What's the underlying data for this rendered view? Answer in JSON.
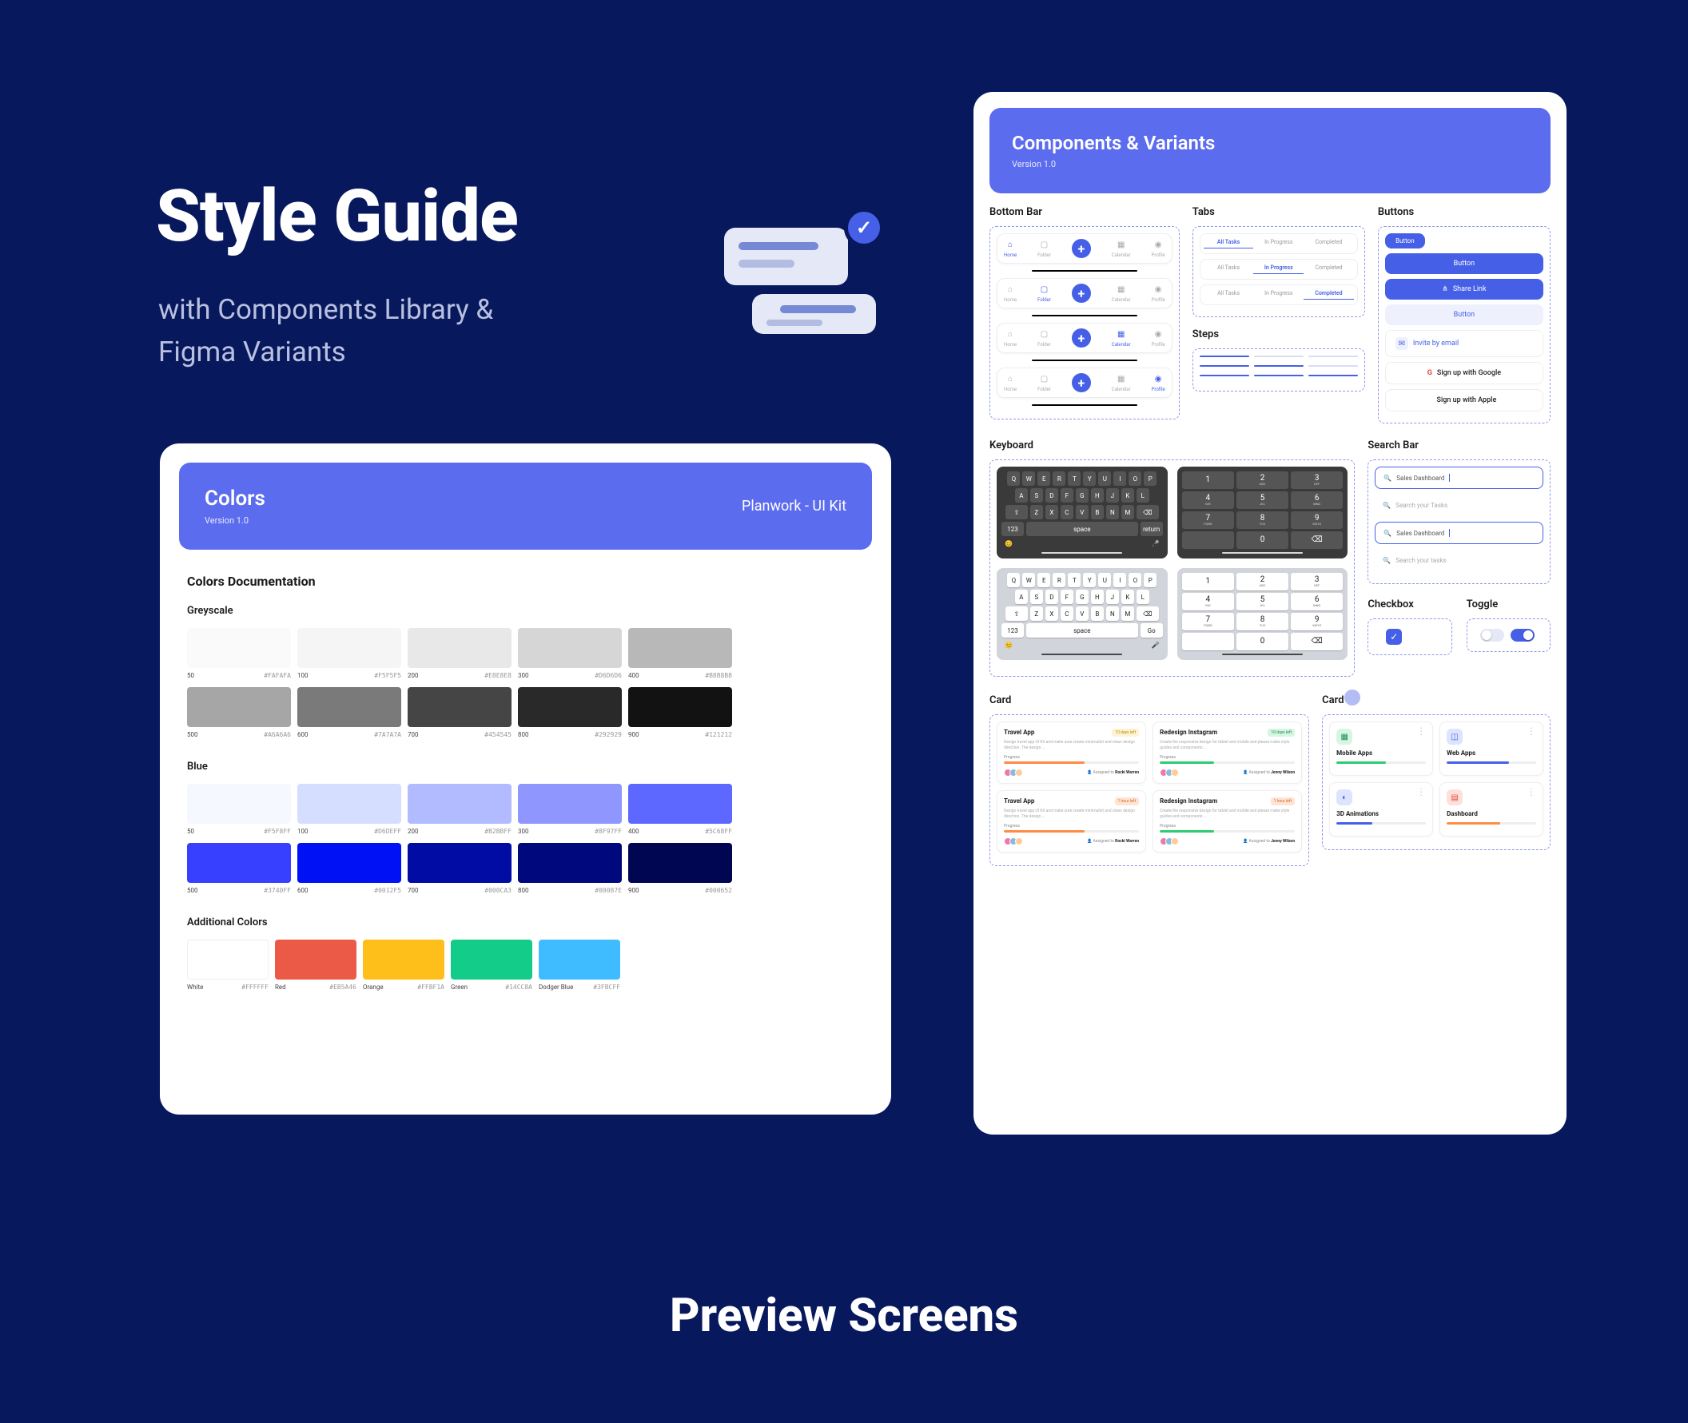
{
  "hero": {
    "title": "Style Guide",
    "subtitle_l1": "with Components Library &",
    "subtitle_l2": "Figma Variants"
  },
  "colors_panel": {
    "title": "Colors",
    "version": "Version 1.0",
    "kit": "Planwork - UI Kit",
    "doc_title": "Colors Documentation",
    "groups": {
      "greyscale": {
        "label": "Greyscale",
        "row1": [
          {
            "step": "50",
            "hex": "#FAFAFA"
          },
          {
            "step": "100",
            "hex": "#F5F5F5"
          },
          {
            "step": "200",
            "hex": "#E8E8E8"
          },
          {
            "step": "300",
            "hex": "#D6D6D6"
          },
          {
            "step": "400",
            "hex": "#B8B8B8"
          }
        ],
        "row2": [
          {
            "step": "500",
            "hex": "#A6A6A6"
          },
          {
            "step": "600",
            "hex": "#7A7A7A"
          },
          {
            "step": "700",
            "hex": "#454545"
          },
          {
            "step": "800",
            "hex": "#292929"
          },
          {
            "step": "900",
            "hex": "#121212"
          }
        ]
      },
      "blue": {
        "label": "Blue",
        "row1": [
          {
            "step": "50",
            "hex": "#F5F8FF"
          },
          {
            "step": "100",
            "hex": "#D6DEFF"
          },
          {
            "step": "200",
            "hex": "#B2BBFF"
          },
          {
            "step": "300",
            "hex": "#8F97FF"
          },
          {
            "step": "400",
            "hex": "#5C68FF"
          }
        ],
        "row2": [
          {
            "step": "500",
            "hex": "#3740FF"
          },
          {
            "step": "600",
            "hex": "#0012F5"
          },
          {
            "step": "700",
            "hex": "#000CA3"
          },
          {
            "step": "800",
            "hex": "#00087E"
          },
          {
            "step": "900",
            "hex": "#000652"
          }
        ]
      },
      "additional": {
        "label": "Additional Colors",
        "items": [
          {
            "name": "White",
            "hex": "#FFFFFF"
          },
          {
            "name": "Red",
            "hex": "#EB5A46"
          },
          {
            "name": "Orange",
            "hex": "#FFBF1A"
          },
          {
            "name": "Green",
            "hex": "#14CC8A"
          },
          {
            "name": "Dodger Blue",
            "hex": "#3FBCFF"
          }
        ]
      }
    }
  },
  "components_panel": {
    "title": "Components & Variants",
    "version": "Version 1.0",
    "sections": {
      "bottom_bar": {
        "title": "Bottom Bar",
        "items": [
          "Home",
          "Folder",
          "",
          "Calendar",
          "Profile"
        ]
      },
      "tabs": {
        "title": "Tabs",
        "labels": [
          "All Tasks",
          "In Progress",
          "Completed"
        ]
      },
      "steps": {
        "title": "Steps"
      },
      "buttons": {
        "title": "Buttons",
        "small": "Button",
        "primary": "Button",
        "share": "Share Link",
        "ghost": "Button",
        "invite": "Invite by email",
        "google": "Sign up with Google",
        "apple": "Sign up with Apple"
      },
      "keyboard": {
        "title": "Keyboard",
        "qwerty_r1": [
          "Q",
          "W",
          "E",
          "R",
          "T",
          "Y",
          "U",
          "I",
          "O",
          "P"
        ],
        "qwerty_r2": [
          "A",
          "S",
          "D",
          "F",
          "G",
          "H",
          "J",
          "K",
          "L"
        ],
        "qwerty_r3": [
          "Z",
          "X",
          "C",
          "V",
          "B",
          "N",
          "M"
        ],
        "space": "space",
        "return": "return",
        "go": "Go",
        "num123": "123",
        "numpad": [
          [
            "1",
            ""
          ],
          [
            "2",
            "ABC"
          ],
          [
            "3",
            "DEF"
          ],
          [
            "4",
            "GHI"
          ],
          [
            "5",
            "JKL"
          ],
          [
            "6",
            "MNO"
          ],
          [
            "7",
            "PQRS"
          ],
          [
            "8",
            "TUV"
          ],
          [
            "9",
            "WXYZ"
          ],
          [
            "",
            ""
          ],
          [
            "0",
            ""
          ],
          [
            "⌫",
            ""
          ]
        ]
      },
      "search": {
        "title": "Search Bar",
        "value": "Sales Dashboard",
        "placeholder": "Search your Tasks",
        "placeholder2": "Search your tasks"
      },
      "checkbox": {
        "title": "Checkbox"
      },
      "toggle": {
        "title": "Toggle"
      },
      "cards": {
        "title": "Card",
        "travel": {
          "title": "Travel App",
          "badge_due": "10 days left",
          "badge_hour": "1 hour left",
          "desc": "Design travel app UI Kit and make sure create minimalist and clean design direction. The design ...",
          "progress": "Progress",
          "assigned": "Assigned to",
          "person": "Rocki Warren"
        },
        "redesign": {
          "title": "Redesign Instagram",
          "badge_due": "10 days left",
          "badge_hour": "1 hour left",
          "desc": "Create the responsive design for tablet and mobile and please make style guides and components ...",
          "assigned": "Assigned to",
          "person": "Jenny Wilson"
        },
        "apps": {
          "mobile": "Mobile Apps",
          "web": "Web Apps",
          "anim": "3D Animations",
          "dash": "Dashboard"
        }
      }
    }
  },
  "footer": "Preview Screens"
}
